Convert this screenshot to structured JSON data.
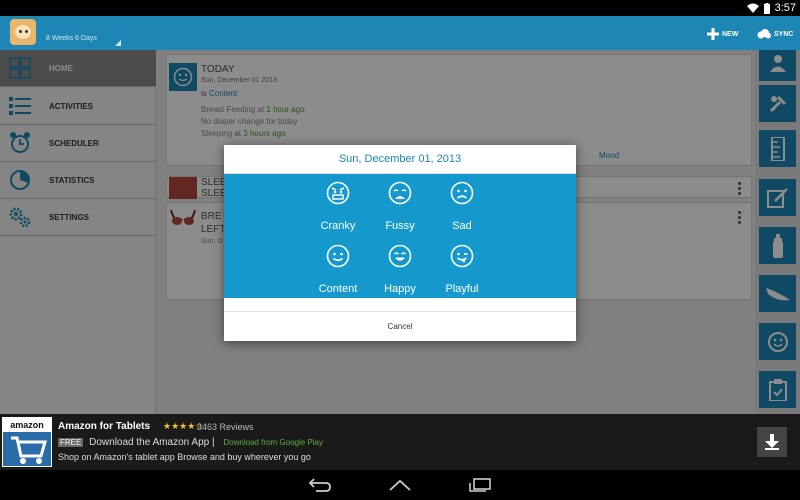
{
  "status_bar": {
    "time": "3:57"
  },
  "action_bar": {
    "baby_age": "8 Weeks 6 Days",
    "new_label": "NEW",
    "sync_label": "SYNC"
  },
  "nav": {
    "items": [
      {
        "label": "HOME",
        "icon": "home-grid-icon",
        "active": true
      },
      {
        "label": "ACTIVITIES",
        "icon": "list-icon",
        "active": false
      },
      {
        "label": "SCHEDULER",
        "icon": "alarm-clock-icon",
        "active": false
      },
      {
        "label": "STATISTICS",
        "icon": "pie-chart-icon",
        "active": false
      },
      {
        "label": "SETTINGS",
        "icon": "gears-icon",
        "active": false
      }
    ]
  },
  "today_card": {
    "title": "TODAY",
    "date": "Sun, December 01 2013",
    "mood_prefix": "is",
    "mood_value": "Content",
    "breastfeeding_prefix": "Breast Feeding at",
    "breastfeeding_time": "1 hour ago",
    "diaper_text": "No diaper change for today",
    "sleeping_prefix": "Sleeping at",
    "sleeping_time": "3 hours ago",
    "mood_link": "Mood"
  },
  "entries": {
    "sleep_title": "SLEE",
    "sleep_title_2": "SLEE",
    "breast_title": "BRE",
    "breast_side": "LEFT",
    "breast_date": "Sun, D"
  },
  "rail": {
    "buttons": [
      "baby-profile-icon",
      "tools-icon",
      "ruler-icon",
      "notes-icon",
      "bottle-icon",
      "diaper-icon",
      "mood-face-icon",
      "clipboard-icon"
    ]
  },
  "dialog": {
    "title": "Sun, December 01, 2013",
    "moods": [
      "Cranky",
      "Fussy",
      "Sad",
      "Content",
      "Happy",
      "Playful"
    ],
    "cancel": "Cancel"
  },
  "ad": {
    "logo_text": "amazon",
    "title": "Amazon for Tablets",
    "stars": "★★★★☆",
    "reviews": "3463 Reviews",
    "free_tag": "FREE",
    "line2": "Download the Amazon App |",
    "play_text": "Download from Google Play",
    "line3": "Shop on Amazon's tablet app Browse and buy wherever you go"
  },
  "colors": {
    "primary": "#1d86b5",
    "dialog_grid": "#1599cc",
    "ad_background": "#1a1a1a"
  }
}
